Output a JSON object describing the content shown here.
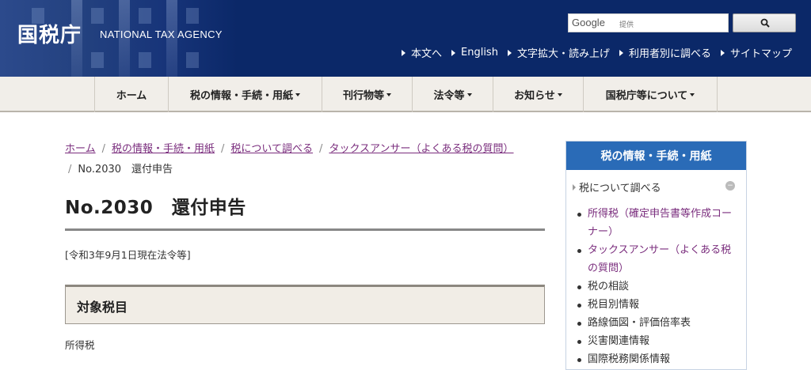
{
  "header": {
    "logo_jp": "国税庁",
    "logo_en": "NATIONAL TAX AGENCY",
    "search": {
      "brand": "Google",
      "sub": "提供",
      "button_icon": "search-icon"
    },
    "util_links": [
      "本文へ",
      "English",
      "文字拡大・読み上げ",
      "利用者別に調べる",
      "サイトマップ"
    ]
  },
  "gnav": [
    {
      "label": "ホーム",
      "dropdown": false
    },
    {
      "label": "税の情報・手続・用紙",
      "dropdown": true
    },
    {
      "label": "刊行物等",
      "dropdown": true
    },
    {
      "label": "法令等",
      "dropdown": true
    },
    {
      "label": "お知らせ",
      "dropdown": true
    },
    {
      "label": "国税庁等について",
      "dropdown": true
    }
  ],
  "breadcrumb": [
    "ホーム",
    "税の情報・手続・用紙",
    "税について調べる",
    "タックスアンサー（よくある税の質問）"
  ],
  "breadcrumb_current": "No.2030　還付申告",
  "page": {
    "title": "No.2030　還付申告",
    "as_of": "[令和3年9月1日現在法令等]",
    "section_title": "対象税目",
    "section_body": "所得税"
  },
  "side": {
    "heading": "税の情報・手続・用紙",
    "category": "税について調べる",
    "items": [
      {
        "label": "所得税（確定申告書等作成コーナー）",
        "link": true
      },
      {
        "label": "タックスアンサー（よくある税の質問）",
        "link": true
      },
      {
        "label": "税の相談",
        "link": false
      },
      {
        "label": "税目別情報",
        "link": false
      },
      {
        "label": "路線価図・評価倍率表",
        "link": false
      },
      {
        "label": "災害関連情報",
        "link": false
      },
      {
        "label": "国際税務関係情報",
        "link": false
      }
    ]
  },
  "colors": {
    "header_bg": "#0b2868",
    "nav_bg": "#f1eee9",
    "link_visited": "#7a2d7d",
    "side_head": "#2a6bb7"
  }
}
